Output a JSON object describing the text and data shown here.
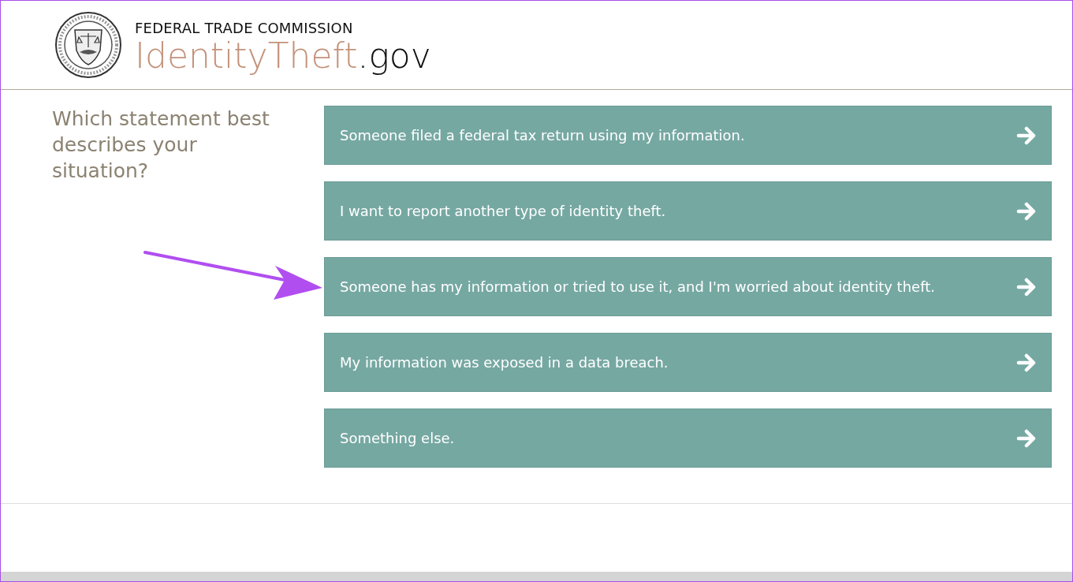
{
  "header": {
    "agency": "FEDERAL TRADE COMMISSION",
    "site_name": "IdentityTheft",
    "site_suffix": ".gov"
  },
  "question": "Which statement best describes your situation?",
  "options": [
    {
      "label": "Someone filed a federal tax return using my information."
    },
    {
      "label": "I want to report another type of identity theft."
    },
    {
      "label": "Someone has my information or tried to use it, and I'm worried about identity theft."
    },
    {
      "label": "My information was exposed in a data breach."
    },
    {
      "label": "Something else."
    }
  ]
}
